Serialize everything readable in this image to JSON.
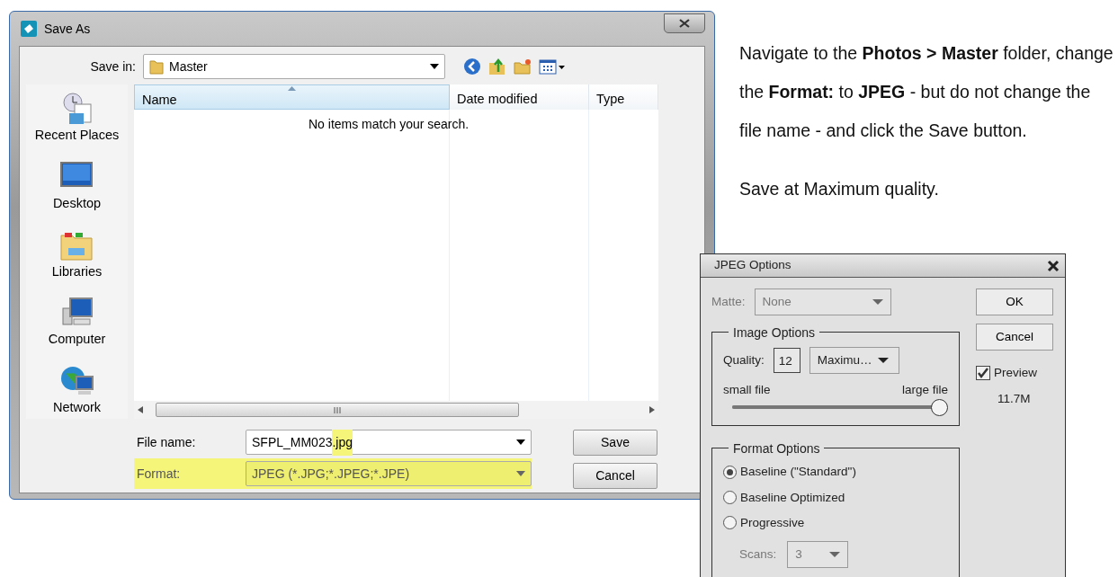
{
  "save_as": {
    "title": "Save As",
    "save_in_label": "Save in:",
    "save_in": "Master",
    "places": [
      {
        "kind": "recent",
        "label": "Recent Places"
      },
      {
        "kind": "desktop",
        "label": "Desktop"
      },
      {
        "kind": "libraries",
        "label": "Libraries"
      },
      {
        "kind": "computer",
        "label": "Computer"
      },
      {
        "kind": "network",
        "label": "Network"
      }
    ],
    "columns": [
      {
        "label": "Name",
        "sorted": true
      },
      {
        "label": "Date modified",
        "sorted": false
      },
      {
        "label": "Type",
        "sorted": false
      }
    ],
    "empty_message": "No items match your search.",
    "file_name_label": "File name:",
    "file_name": {
      "stem": "SFPL_MM023",
      "extension": ".jpg",
      "extension_highlighted": true
    },
    "format_label": "Format:",
    "format": "JPEG (*.JPG;*.JPEG;*.JPE)",
    "format_highlighted": true,
    "buttons": [
      "Save",
      "Cancel"
    ]
  },
  "instructions": [
    "Navigate to the **Photos > Master** folder, change the **Format:** to **JPEG** - but do not change the file name - and click the Save button.",
    "Save at Maximum quality."
  ],
  "jpeg_options": {
    "title": "JPEG Options",
    "matte_label": "Matte:",
    "matte": "None",
    "matte_disabled": true,
    "image_options_legend": "Image Options",
    "quality_label": "Quality:",
    "quality": "12",
    "quality_preset": "Maximu…",
    "small_label": "small file",
    "large_label": "large file",
    "slider": {
      "level": 1.0
    },
    "format_options_legend": "Format Options",
    "format_options": [
      {
        "label": "Baseline (\"Standard\")",
        "selected": true
      },
      {
        "label": "Baseline Optimized",
        "selected": false
      },
      {
        "label": "Progressive",
        "selected": false
      }
    ],
    "scans_label": "Scans:",
    "scans": "3",
    "scans_disabled": true,
    "buttons": [
      "OK",
      "Cancel"
    ],
    "preview": {
      "label": "Preview",
      "checked": true
    },
    "size": "11.7M"
  }
}
